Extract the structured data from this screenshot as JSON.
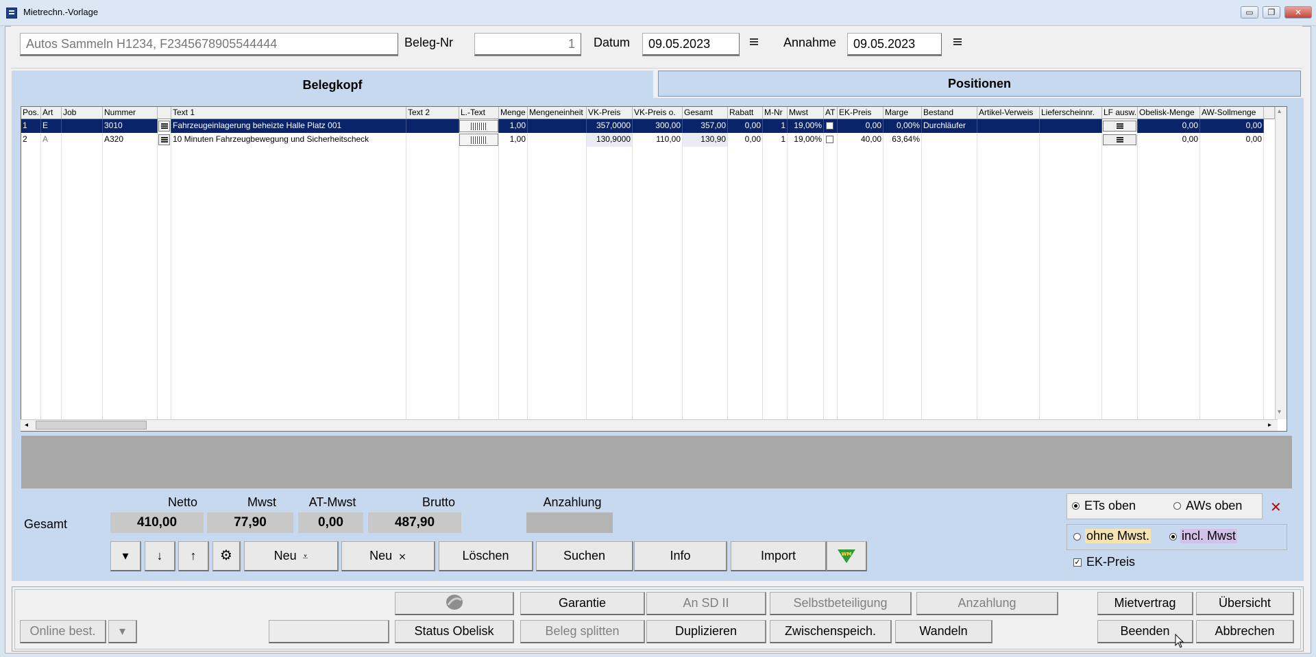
{
  "window": {
    "title": "Mietrechn.-Vorlage",
    "minimize": "▭",
    "restore": "❐",
    "close": "✕"
  },
  "header": {
    "customer": "Autos Sammeln H1234, F2345678905544444",
    "beleg_label": "Beleg-Nr",
    "beleg_value": "1",
    "datum_label": "Datum",
    "datum_value": "09.05.2023",
    "annahme_label": "Annahme",
    "annahme_value": "09.05.2023"
  },
  "tabs": {
    "belegkopf": "Belegkopf",
    "positionen": "Positionen"
  },
  "grid": {
    "columns": [
      "Pos.",
      "Art",
      "Job",
      "Nummer",
      "",
      "Text 1",
      "Text 2",
      "L.-Text",
      "Menge",
      "Mengeneinheit",
      "VK-Preis",
      "VK-Preis o.",
      "Gesamt",
      "Rabatt",
      "M-Nr",
      "Mwst",
      "AT",
      "EK-Preis",
      "Marge",
      "Bestand",
      "Artikel-Verweis",
      "Lieferscheinnr.",
      "LF ausw.",
      "Obelisk-Menge",
      "AW-Sollmenge",
      ""
    ],
    "rows": [
      {
        "pos": "1",
        "art": "E",
        "job": "",
        "nummer": "3010",
        "text1": "Fahrzeugeinlagerung beheizte Halle Platz 001",
        "text2": "",
        "menge": "1,00",
        "einheit": "",
        "vk": "357,0000",
        "vko": "300,00",
        "gesamt": "357,00",
        "rabatt": "0,00",
        "mnr": "1",
        "mwst": "19,00%",
        "ek": "0,00",
        "marge": "0,00%",
        "bestand": "Durchläufer",
        "verweis": "",
        "lieferschein": "",
        "obelisk": "0,00",
        "aw": "0,00"
      },
      {
        "pos": "2",
        "art": "A",
        "job": "",
        "nummer": "A320",
        "text1": "10 Minuten Fahrzeugbewegung und Sicherheitscheck",
        "text2": "",
        "menge": "1,00",
        "einheit": "",
        "vk": "130,9000",
        "vko": "110,00",
        "gesamt": "130,90",
        "rabatt": "0,00",
        "mnr": "1",
        "mwst": "19,00%",
        "ek": "40,00",
        "marge": "63,64%",
        "bestand": "",
        "verweis": "",
        "lieferschein": "",
        "obelisk": "0,00",
        "aw": "0,00"
      }
    ]
  },
  "totals": {
    "label": "Gesamt",
    "netto_label": "Netto",
    "netto": "410,00",
    "mwst_label": "Mwst",
    "mwst": "77,90",
    "atmwst_label": "AT-Mwst",
    "atmwst": "0,00",
    "brutto_label": "Brutto",
    "brutto": "487,90",
    "anzahlung_label": "Anzahlung",
    "anzahlung": ""
  },
  "toolbar": {
    "down_arrow": "▾",
    "move_down": "↓",
    "move_up": "↑",
    "settings": "⚙",
    "neu1": "Neu",
    "neu2": "Neu",
    "loeschen": "Löschen",
    "suchen": "Suchen",
    "info": "Info",
    "import": "Import",
    "wm": "WM"
  },
  "options": {
    "ets_oben": "ETs oben",
    "aws_oben": "AWs oben",
    "ohne_mwst": "ohne Mwst.",
    "incl_mwst": "incl. Mwst",
    "ek_preis": "EK-Preis",
    "clear": "✕"
  },
  "bottom": {
    "online_best": "Online best.",
    "online_drop": "▾",
    "garantie": "Garantie",
    "an_sd": "An SD II",
    "selbstbeteiligung": "Selbstbeteiligung",
    "anzahlung": "Anzahlung",
    "mietvertrag": "Mietvertrag",
    "uebersicht": "Übersicht",
    "status_obelisk": "Status Obelisk",
    "beleg_splitten": "Beleg splitten",
    "duplizieren": "Duplizieren",
    "zwischenspeich": "Zwischenspeich.",
    "wandeln": "Wandeln",
    "beenden": "Beenden",
    "abbrechen": "Abbrechen"
  },
  "colors": {
    "accent": "#c6d9ee",
    "selection": "#0a246a",
    "close_x": "#c00000"
  }
}
